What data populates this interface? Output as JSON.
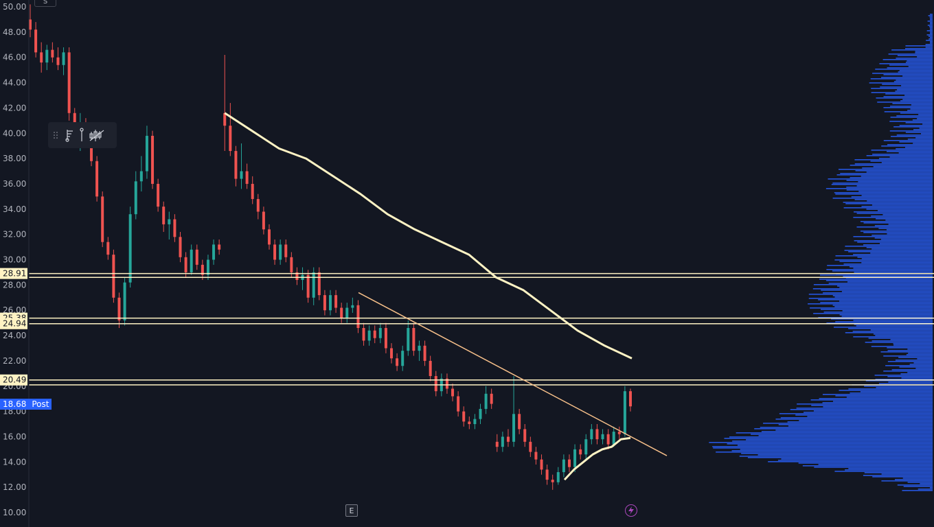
{
  "chart_data": {
    "type": "candlestick",
    "ylim": [
      9.5,
      50.5
    ],
    "y_ticks": [
      "50.00",
      "48.00",
      "46.00",
      "44.00",
      "42.00",
      "40.00",
      "38.00",
      "36.00",
      "34.00",
      "32.00",
      "30.00",
      "28.00",
      "26.00",
      "24.00",
      "22.00",
      "20.00",
      "18.00",
      "16.00",
      "14.00",
      "12.00",
      "10.00"
    ],
    "candles": [
      {
        "o": 49.0,
        "h": 50.2,
        "l": 47.6,
        "c": 48.2
      },
      {
        "o": 48.2,
        "h": 48.8,
        "l": 46.0,
        "c": 46.4
      },
      {
        "o": 46.4,
        "h": 47.2,
        "l": 44.8,
        "c": 45.6
      },
      {
        "o": 45.6,
        "h": 47.0,
        "l": 45.0,
        "c": 46.6
      },
      {
        "o": 46.6,
        "h": 47.2,
        "l": 45.6,
        "c": 46.0
      },
      {
        "o": 46.0,
        "h": 46.8,
        "l": 45.0,
        "c": 45.4
      },
      {
        "o": 45.4,
        "h": 46.8,
        "l": 44.6,
        "c": 46.4
      },
      {
        "o": 46.4,
        "h": 46.8,
        "l": 41.0,
        "c": 41.6
      },
      {
        "o": 41.6,
        "h": 42.0,
        "l": 39.2,
        "c": 39.8
      },
      {
        "o": 39.8,
        "h": 41.6,
        "l": 38.6,
        "c": 40.6
      },
      {
        "o": 40.6,
        "h": 41.2,
        "l": 39.6,
        "c": 40.0
      },
      {
        "o": 40.0,
        "h": 40.4,
        "l": 37.4,
        "c": 37.8
      },
      {
        "o": 37.8,
        "h": 38.2,
        "l": 34.6,
        "c": 35.0
      },
      {
        "o": 35.0,
        "h": 35.4,
        "l": 31.0,
        "c": 31.4
      },
      {
        "o": 31.4,
        "h": 31.8,
        "l": 30.0,
        "c": 30.4
      },
      {
        "o": 30.4,
        "h": 30.8,
        "l": 26.6,
        "c": 27.0
      },
      {
        "o": 27.0,
        "h": 27.4,
        "l": 24.6,
        "c": 25.2
      },
      {
        "o": 25.2,
        "h": 28.6,
        "l": 24.8,
        "c": 28.2
      },
      {
        "o": 28.2,
        "h": 34.2,
        "l": 27.8,
        "c": 33.6
      },
      {
        "o": 33.6,
        "h": 37.0,
        "l": 33.2,
        "c": 36.2
      },
      {
        "o": 36.2,
        "h": 38.2,
        "l": 35.4,
        "c": 37.0
      },
      {
        "o": 37.0,
        "h": 40.6,
        "l": 36.4,
        "c": 39.8
      },
      {
        "o": 39.8,
        "h": 40.2,
        "l": 35.6,
        "c": 36.0
      },
      {
        "o": 36.0,
        "h": 36.4,
        "l": 33.8,
        "c": 34.2
      },
      {
        "o": 34.2,
        "h": 34.6,
        "l": 32.2,
        "c": 32.8
      },
      {
        "o": 32.8,
        "h": 33.8,
        "l": 31.6,
        "c": 33.2
      },
      {
        "o": 33.2,
        "h": 33.6,
        "l": 31.4,
        "c": 31.8
      },
      {
        "o": 31.8,
        "h": 32.2,
        "l": 29.8,
        "c": 30.2
      },
      {
        "o": 30.2,
        "h": 30.6,
        "l": 28.6,
        "c": 29.0
      },
      {
        "o": 29.0,
        "h": 31.2,
        "l": 28.8,
        "c": 30.8
      },
      {
        "o": 30.8,
        "h": 31.2,
        "l": 29.2,
        "c": 29.6
      },
      {
        "o": 29.6,
        "h": 30.0,
        "l": 28.4,
        "c": 28.8
      },
      {
        "o": 28.8,
        "h": 30.4,
        "l": 28.4,
        "c": 30.0
      },
      {
        "o": 30.0,
        "h": 31.6,
        "l": 29.6,
        "c": 31.2
      },
      {
        "o": 31.2,
        "h": 31.6,
        "l": 30.4,
        "c": 30.8
      },
      {
        "o": 41.6,
        "h": 46.2,
        "l": 38.6,
        "c": 40.6
      },
      {
        "o": 40.6,
        "h": 42.4,
        "l": 38.2,
        "c": 38.6
      },
      {
        "o": 38.6,
        "h": 39.0,
        "l": 35.8,
        "c": 36.4
      },
      {
        "o": 36.4,
        "h": 39.2,
        "l": 35.6,
        "c": 37.0
      },
      {
        "o": 37.0,
        "h": 37.6,
        "l": 35.6,
        "c": 36.0
      },
      {
        "o": 36.0,
        "h": 36.6,
        "l": 34.4,
        "c": 34.8
      },
      {
        "o": 34.8,
        "h": 35.2,
        "l": 33.2,
        "c": 33.8
      },
      {
        "o": 33.8,
        "h": 34.2,
        "l": 32.0,
        "c": 32.4
      },
      {
        "o": 32.4,
        "h": 32.8,
        "l": 30.8,
        "c": 31.2
      },
      {
        "o": 31.2,
        "h": 31.6,
        "l": 29.6,
        "c": 30.0
      },
      {
        "o": 30.0,
        "h": 31.6,
        "l": 29.6,
        "c": 31.2
      },
      {
        "o": 31.2,
        "h": 31.6,
        "l": 29.8,
        "c": 30.2
      },
      {
        "o": 30.2,
        "h": 30.6,
        "l": 28.6,
        "c": 29.0
      },
      {
        "o": 29.0,
        "h": 29.4,
        "l": 28.0,
        "c": 28.4
      },
      {
        "o": 28.4,
        "h": 29.4,
        "l": 27.6,
        "c": 28.8
      },
      {
        "o": 28.8,
        "h": 29.2,
        "l": 26.6,
        "c": 27.0
      },
      {
        "o": 27.0,
        "h": 29.4,
        "l": 26.4,
        "c": 29.0
      },
      {
        "o": 29.0,
        "h": 29.4,
        "l": 26.8,
        "c": 27.2
      },
      {
        "o": 27.2,
        "h": 27.6,
        "l": 25.6,
        "c": 26.0
      },
      {
        "o": 26.0,
        "h": 27.6,
        "l": 25.6,
        "c": 27.2
      },
      {
        "o": 27.2,
        "h": 27.6,
        "l": 25.8,
        "c": 26.2
      },
      {
        "o": 26.2,
        "h": 26.6,
        "l": 25.0,
        "c": 25.4
      },
      {
        "o": 25.4,
        "h": 26.6,
        "l": 25.0,
        "c": 26.2
      },
      {
        "o": 26.2,
        "h": 27.0,
        "l": 25.8,
        "c": 26.4
      },
      {
        "o": 26.4,
        "h": 26.8,
        "l": 24.2,
        "c": 24.6
      },
      {
        "o": 24.6,
        "h": 25.0,
        "l": 23.2,
        "c": 23.6
      },
      {
        "o": 23.6,
        "h": 24.8,
        "l": 23.2,
        "c": 24.4
      },
      {
        "o": 24.4,
        "h": 24.8,
        "l": 23.4,
        "c": 23.8
      },
      {
        "o": 23.8,
        "h": 25.0,
        "l": 23.4,
        "c": 24.6
      },
      {
        "o": 24.6,
        "h": 25.0,
        "l": 22.6,
        "c": 23.0
      },
      {
        "o": 23.0,
        "h": 23.4,
        "l": 21.8,
        "c": 22.2
      },
      {
        "o": 22.2,
        "h": 22.6,
        "l": 21.2,
        "c": 21.6
      },
      {
        "o": 21.6,
        "h": 23.2,
        "l": 21.2,
        "c": 22.8
      },
      {
        "o": 22.8,
        "h": 25.2,
        "l": 22.4,
        "c": 24.6
      },
      {
        "o": 24.6,
        "h": 25.0,
        "l": 22.4,
        "c": 22.8
      },
      {
        "o": 22.8,
        "h": 23.6,
        "l": 22.0,
        "c": 23.2
      },
      {
        "o": 23.2,
        "h": 23.6,
        "l": 21.6,
        "c": 22.0
      },
      {
        "o": 22.0,
        "h": 22.4,
        "l": 20.4,
        "c": 20.8
      },
      {
        "o": 20.8,
        "h": 21.2,
        "l": 19.2,
        "c": 19.6
      },
      {
        "o": 19.6,
        "h": 21.0,
        "l": 19.2,
        "c": 20.6
      },
      {
        "o": 20.6,
        "h": 21.0,
        "l": 19.4,
        "c": 19.8
      },
      {
        "o": 19.8,
        "h": 20.2,
        "l": 18.8,
        "c": 19.2
      },
      {
        "o": 19.2,
        "h": 19.6,
        "l": 17.6,
        "c": 18.0
      },
      {
        "o": 18.0,
        "h": 18.4,
        "l": 16.8,
        "c": 17.2
      },
      {
        "o": 17.2,
        "h": 17.6,
        "l": 16.6,
        "c": 17.0
      },
      {
        "o": 17.0,
        "h": 17.8,
        "l": 16.6,
        "c": 17.4
      },
      {
        "o": 17.4,
        "h": 18.6,
        "l": 17.0,
        "c": 18.2
      },
      {
        "o": 18.2,
        "h": 20.0,
        "l": 17.8,
        "c": 19.4
      },
      {
        "o": 19.4,
        "h": 19.8,
        "l": 18.2,
        "c": 18.6
      },
      {
        "o": 15.6,
        "h": 16.2,
        "l": 14.8,
        "c": 15.2
      },
      {
        "o": 15.2,
        "h": 16.4,
        "l": 14.8,
        "c": 16.0
      },
      {
        "o": 16.0,
        "h": 16.6,
        "l": 15.2,
        "c": 15.6
      },
      {
        "o": 15.6,
        "h": 20.8,
        "l": 15.2,
        "c": 17.8
      },
      {
        "o": 17.8,
        "h": 18.2,
        "l": 16.2,
        "c": 16.6
      },
      {
        "o": 16.6,
        "h": 17.0,
        "l": 15.2,
        "c": 15.6
      },
      {
        "o": 15.6,
        "h": 16.0,
        "l": 14.4,
        "c": 14.8
      },
      {
        "o": 14.8,
        "h": 15.2,
        "l": 13.8,
        "c": 14.2
      },
      {
        "o": 14.2,
        "h": 14.6,
        "l": 13.0,
        "c": 13.4
      },
      {
        "o": 13.4,
        "h": 13.8,
        "l": 12.2,
        "c": 12.6
      },
      {
        "o": 12.6,
        "h": 13.0,
        "l": 11.8,
        "c": 12.4
      },
      {
        "o": 12.4,
        "h": 13.6,
        "l": 12.2,
        "c": 13.2
      },
      {
        "o": 13.2,
        "h": 14.6,
        "l": 12.8,
        "c": 14.2
      },
      {
        "o": 14.2,
        "h": 14.6,
        "l": 13.2,
        "c": 13.6
      },
      {
        "o": 13.6,
        "h": 15.4,
        "l": 13.2,
        "c": 15.0
      },
      {
        "o": 15.0,
        "h": 15.4,
        "l": 14.2,
        "c": 14.6
      },
      {
        "o": 14.6,
        "h": 16.2,
        "l": 14.2,
        "c": 15.8
      },
      {
        "o": 15.8,
        "h": 17.0,
        "l": 15.4,
        "c": 16.6
      },
      {
        "o": 16.6,
        "h": 17.0,
        "l": 15.4,
        "c": 15.8
      },
      {
        "o": 15.8,
        "h": 16.6,
        "l": 15.4,
        "c": 16.2
      },
      {
        "o": 16.2,
        "h": 16.6,
        "l": 15.0,
        "c": 15.4
      },
      {
        "o": 15.4,
        "h": 16.8,
        "l": 15.2,
        "c": 16.4
      },
      {
        "o": 16.4,
        "h": 16.8,
        "l": 15.8,
        "c": 16.2
      },
      {
        "o": 16.2,
        "h": 20.0,
        "l": 16.0,
        "c": 19.6
      },
      {
        "o": 19.6,
        "h": 19.8,
        "l": 18.0,
        "c": 18.4
      }
    ],
    "vwap_top": [
      [
        41.6,
        40.2
      ],
      [
        38.8,
        38.0
      ],
      [
        36.6,
        35.2
      ],
      [
        33.6,
        32.4
      ],
      [
        31.4,
        30.4
      ],
      [
        28.6,
        27.6
      ],
      [
        26.0,
        24.4
      ],
      [
        23.2,
        22.2
      ]
    ],
    "vwap_bottom": [
      [
        12.6,
        13.4
      ],
      [
        14.0,
        14.6
      ],
      [
        15.0,
        15.2
      ],
      [
        15.8,
        15.9
      ]
    ],
    "trendline": {
      "start": 27.4,
      "end": 14.5
    },
    "levels": [
      {
        "label": "28.91",
        "value": 28.91
      },
      {
        "label": "",
        "value": 28.6
      },
      {
        "label": "25.38",
        "value": 25.38
      },
      {
        "label": "24.94",
        "value": 24.94
      },
      {
        "label": "20.49",
        "value": 20.49
      },
      {
        "label": "",
        "value": 20.1
      }
    ],
    "current_price": "18.68",
    "session_label": "Post",
    "volume_profile_color": "#2962ff",
    "up_color": "#26a69a",
    "down_color": "#ef5350",
    "level_color": "#fff3c4",
    "vwap_color": "#fff3c4",
    "trendline_color": "#f7c08a"
  },
  "markers": {
    "earnings": "E",
    "dividend_icon": "lightning-icon"
  },
  "top_button": "S",
  "toolbar": {
    "icons": [
      "drag-handle-icon",
      "hierarchy-icon",
      "pin-icon",
      "candles-icon"
    ]
  }
}
